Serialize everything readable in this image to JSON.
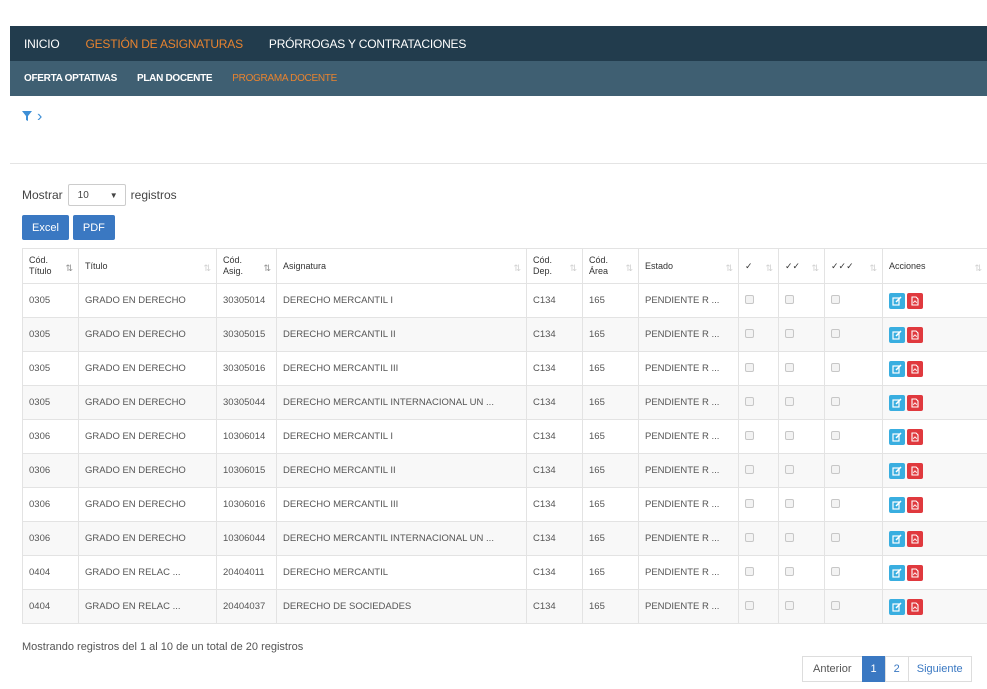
{
  "nav": {
    "items": [
      {
        "label": "INICIO",
        "active": false
      },
      {
        "label": "GESTIÓN DE ASIGNATURAS",
        "active": true
      },
      {
        "label": "PRÓRROGAS Y CONTRATACIONES",
        "active": false
      }
    ]
  },
  "subnav": {
    "items": [
      {
        "label": "OFERTA OPTATIVAS",
        "active": false
      },
      {
        "label": "PLAN DOCENTE",
        "active": false
      },
      {
        "label": "PROGRAMA DOCENTE",
        "active": true
      }
    ]
  },
  "breadcrumb": {
    "chevron": "›"
  },
  "length": {
    "prefix": "Mostrar",
    "value": "10",
    "suffix": "registros"
  },
  "export": {
    "excel": "Excel",
    "pdf": "PDF"
  },
  "table": {
    "headers": [
      {
        "l1": "Cód.",
        "l2": "Título"
      },
      {
        "l1": "",
        "l2": "Título"
      },
      {
        "l1": "Cód.",
        "l2": "Asig."
      },
      {
        "l1": "",
        "l2": "Asignatura"
      },
      {
        "l1": "Cód.",
        "l2": "Dep."
      },
      {
        "l1": "Cód.",
        "l2": "Área"
      },
      {
        "l1": "",
        "l2": "Estado"
      },
      {
        "l1": "",
        "l2": "✓"
      },
      {
        "l1": "",
        "l2": "✓✓"
      },
      {
        "l1": "",
        "l2": "✓✓✓"
      },
      {
        "l1": "",
        "l2": "Acciones"
      }
    ],
    "rows": [
      [
        "0305",
        "GRADO EN DERECHO",
        "30305014",
        "DERECHO MERCANTIL I",
        "C134",
        "165",
        "PENDIENTE R ..."
      ],
      [
        "0305",
        "GRADO EN DERECHO",
        "30305015",
        "DERECHO MERCANTIL II",
        "C134",
        "165",
        "PENDIENTE R ..."
      ],
      [
        "0305",
        "GRADO EN DERECHO",
        "30305016",
        "DERECHO MERCANTIL III",
        "C134",
        "165",
        "PENDIENTE R ..."
      ],
      [
        "0305",
        "GRADO EN DERECHO",
        "30305044",
        "DERECHO MERCANTIL INTERNACIONAL UN ...",
        "C134",
        "165",
        "PENDIENTE R ..."
      ],
      [
        "0306",
        "GRADO EN DERECHO",
        "10306014",
        "DERECHO MERCANTIL I",
        "C134",
        "165",
        "PENDIENTE R ..."
      ],
      [
        "0306",
        "GRADO EN DERECHO",
        "10306015",
        "DERECHO MERCANTIL II",
        "C134",
        "165",
        "PENDIENTE R ..."
      ],
      [
        "0306",
        "GRADO EN DERECHO",
        "10306016",
        "DERECHO MERCANTIL III",
        "C134",
        "165",
        "PENDIENTE R ..."
      ],
      [
        "0306",
        "GRADO EN DERECHO",
        "10306044",
        "DERECHO MERCANTIL INTERNACIONAL UN ...",
        "C134",
        "165",
        "PENDIENTE R ..."
      ],
      [
        "0404",
        "GRADO EN RELAC ...",
        "20404011",
        "DERECHO MERCANTIL",
        "C134",
        "165",
        "PENDIENTE R ..."
      ],
      [
        "0404",
        "GRADO EN RELAC ...",
        "20404037",
        "DERECHO DE SOCIEDADES",
        "C134",
        "165",
        "PENDIENTE R ..."
      ]
    ]
  },
  "info": "Mostrando registros del 1 al 10 de un total de 20 registros",
  "pager": {
    "prev": "Anterior",
    "pages": [
      "1",
      "2"
    ],
    "current": "1",
    "next": "Siguiente"
  },
  "colors": {
    "nav": "#223c4d",
    "subnav": "#3f5f72",
    "accent": "#e8832f",
    "primary": "#3a78c2",
    "edit": "#39aee0",
    "pdf": "#e0393e"
  },
  "icons": {
    "filter": "filter-icon",
    "edit": "edit-icon",
    "pdf": "pdf-icon",
    "sort": "sort-icon"
  }
}
